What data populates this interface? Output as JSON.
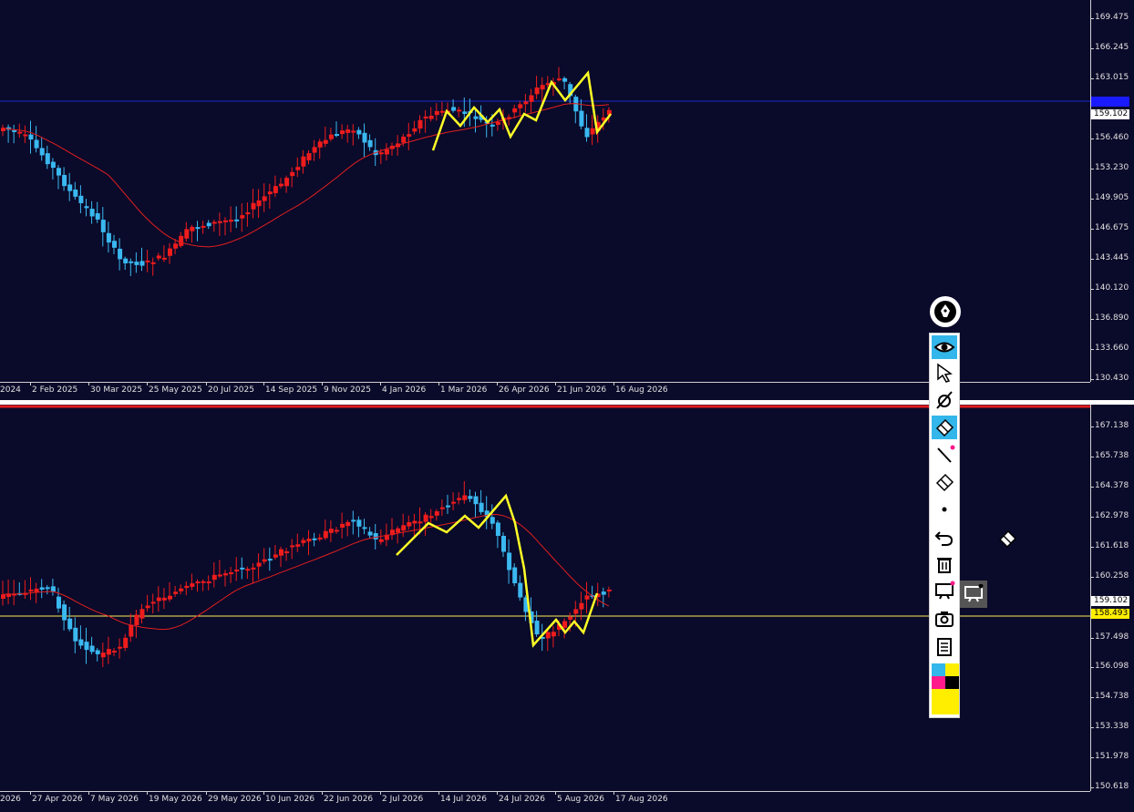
{
  "colors": {
    "background": "#0a0a2a",
    "bull": "#ef1c1c",
    "bear": "#3ab8f0",
    "ma": "#e21f1f",
    "zigzag": "#ffff26",
    "hline_top": "#1c2bd0",
    "hline_bottom": "#ffee55",
    "tag_current": "#ffffff",
    "tag_yellow": "#ffee00",
    "tag_blue": "#1a1aff"
  },
  "top_chart": {
    "price_ticks": [
      "169.475",
      "166.245",
      "163.015",
      "159.102",
      "156.460",
      "153.230",
      "149.905",
      "146.675",
      "143.445",
      "140.120",
      "136.890",
      "133.660",
      "130.430"
    ],
    "current_price": "159.102",
    "date_labels": [
      "2024",
      "2 Feb 2025",
      "30 Mar 2025",
      "25 May 2025",
      "20 Jul 2025",
      "14 Sep 2025",
      "9 Nov 2025",
      "4 Jan 2026",
      "1 Mar 2026",
      "26 Apr 2026",
      "21 Jun 2026",
      "16 Aug 2026"
    ]
  },
  "bottom_chart": {
    "price_ticks": [
      "167.138",
      "165.738",
      "164.378",
      "162.978",
      "161.618",
      "160.258",
      "157.498",
      "156.098",
      "154.738",
      "153.338",
      "151.978",
      "150.618"
    ],
    "current_price": "159.102",
    "line_price": "158.493",
    "date_labels": [
      "2026",
      "27 Apr 2026",
      "7 May 2026",
      "19 May 2026",
      "29 May 2026",
      "10 Jun 2026",
      "22 Jun 2026",
      "2 Jul 2026",
      "14 Jul 2026",
      "24 Jul 2026",
      "5 Aug 2026",
      "17 Aug 2026"
    ]
  },
  "toolbar": {
    "tools": [
      "pen-icon",
      "eye-icon",
      "cursor-icon",
      "hide-drawings-icon",
      "eraser-icon",
      "line-icon",
      "eraser-alt-icon",
      "dot-icon",
      "undo-icon",
      "trash-icon",
      "screen-icon",
      "camera-icon",
      "clipboard-icon"
    ],
    "swatches": [
      "#33b6ea",
      "#ffee00",
      "#ff1a8c",
      "#000000",
      "#ffee00",
      "#ffee00"
    ]
  }
}
